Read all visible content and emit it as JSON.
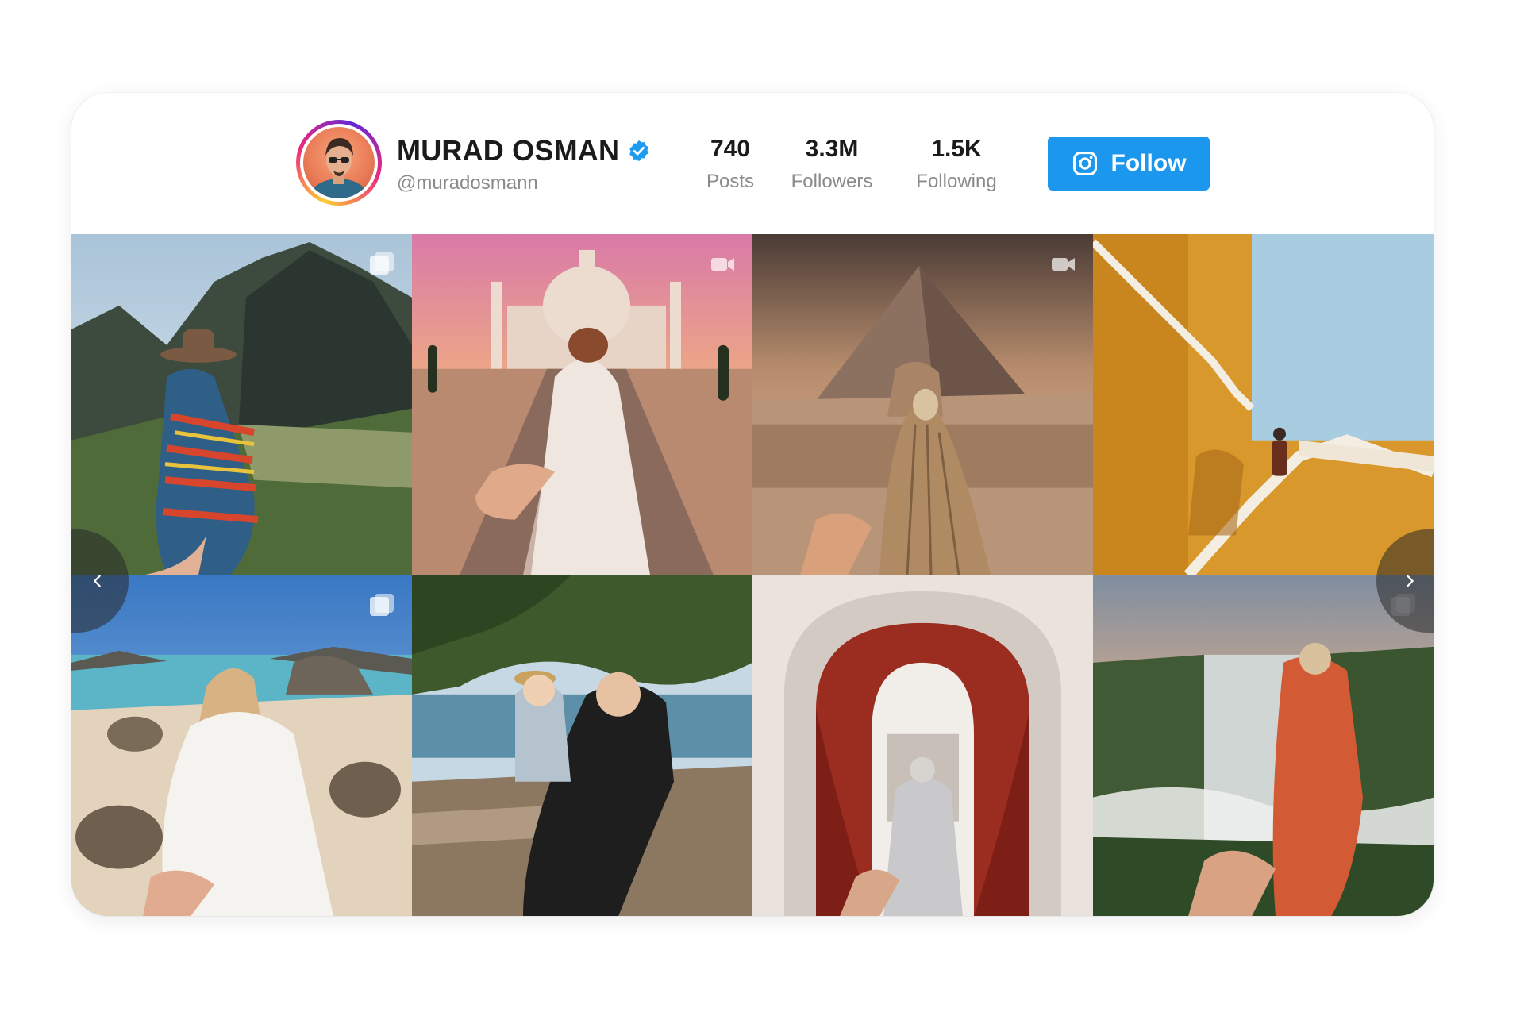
{
  "profile": {
    "name": "MURAD OSMAN",
    "handle": "@muradosmann",
    "verified": true,
    "avatar_icon": "profile-photo"
  },
  "stats": [
    {
      "value": "740",
      "label": "Posts"
    },
    {
      "value": "3.3M",
      "label": "Followers"
    },
    {
      "value": "1.5K",
      "label": "Following"
    }
  ],
  "follow_button": {
    "label": "Follow",
    "icon": "instagram-icon",
    "color": "#1b97ee"
  },
  "colors": {
    "verified_badge": "#1d9bf0",
    "avatar_ring": [
      "#f9ce34",
      "#ee2a7b",
      "#6228d7"
    ]
  },
  "grid": {
    "posts": [
      {
        "scene": "mountain-ruins",
        "badge": "carousel-icon"
      },
      {
        "scene": "taj-mahal",
        "badge": "video-icon"
      },
      {
        "scene": "pyramid-sphinx",
        "badge": "video-icon"
      },
      {
        "scene": "yellow-wall-stairs",
        "badge": ""
      },
      {
        "scene": "beach-tortoises",
        "badge": "carousel-icon"
      },
      {
        "scene": "mother-child-tree",
        "badge": ""
      },
      {
        "scene": "red-curtain-arch",
        "badge": ""
      },
      {
        "scene": "waterfall-gorge",
        "badge": "carousel-icon"
      }
    ]
  },
  "carousel_nav": {
    "prev_icon": "chevron-left-icon",
    "next_icon": "chevron-right-icon"
  }
}
